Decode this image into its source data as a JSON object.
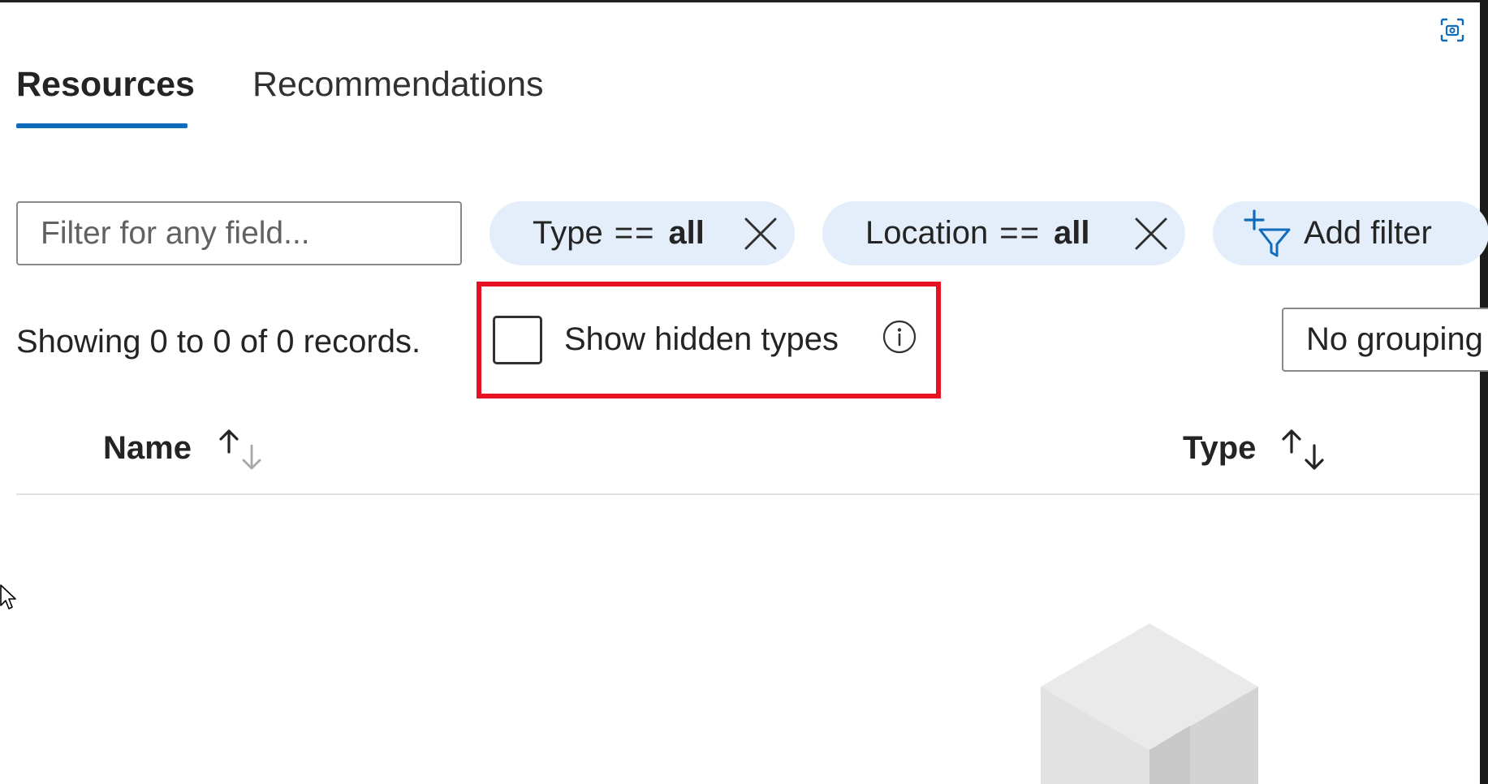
{
  "tabs": [
    {
      "label": "Resources",
      "selected": true
    },
    {
      "label": "Recommendations",
      "selected": false
    }
  ],
  "filter": {
    "placeholder": "Filter for any field...",
    "value": ""
  },
  "pills": [
    {
      "field": "Type",
      "operator": "==",
      "value": "all"
    },
    {
      "field": "Location",
      "operator": "==",
      "value": "all"
    }
  ],
  "add_filter": {
    "label": "Add filter"
  },
  "records": {
    "text": "Showing 0 to 0 of 0 records."
  },
  "hidden_types": {
    "label": "Show hidden types",
    "checked": false
  },
  "grouping": {
    "selected": "No grouping"
  },
  "table": {
    "columns": [
      {
        "label": "Name",
        "sort": "ascending"
      },
      {
        "label": "Type",
        "sort": "none"
      }
    ],
    "rows": []
  },
  "colors": {
    "accent": "#0f6cbd",
    "pill_background": "#e4eefa",
    "highlight": "#e81123"
  },
  "icons": {
    "screen_capture": "screen-capture-icon",
    "close": "close-icon",
    "add_filter": "add-filter-icon",
    "info": "info-icon",
    "sort": "sort-icon",
    "empty_state": "cube-icon"
  }
}
